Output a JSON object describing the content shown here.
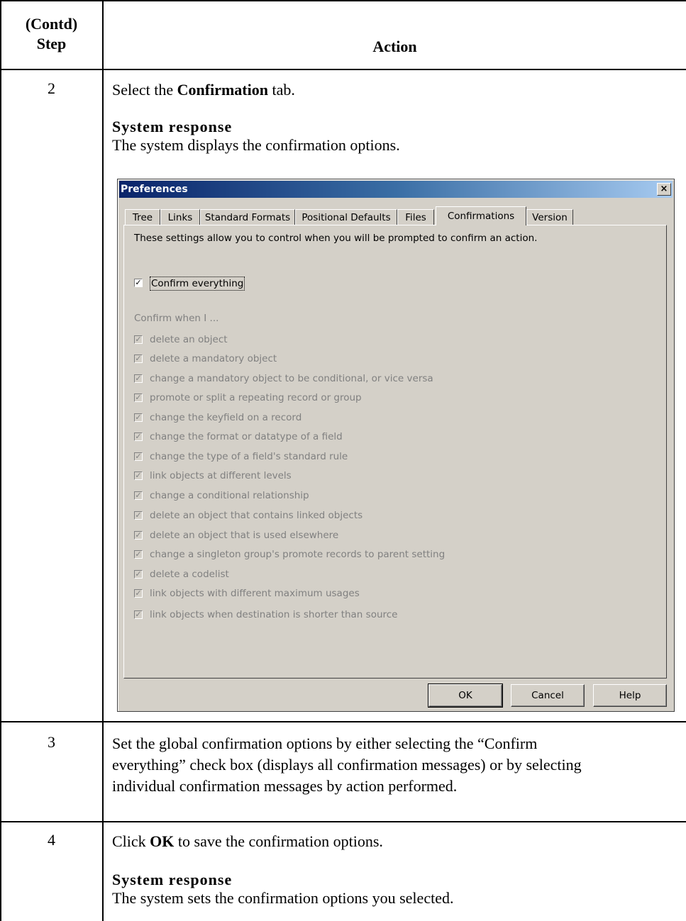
{
  "table": {
    "header_step": "(Contd)\nStep",
    "header_step_line1": "(Contd)",
    "header_step_line2": "Step",
    "header_action": "Action"
  },
  "rows": [
    {
      "step": "2",
      "text_pre": "Select the ",
      "text_bold": "Confirmation",
      "text_post": " tab.",
      "response_label": "System response",
      "response_text": "The system displays the confirmation options."
    },
    {
      "step": "3",
      "text": "Set the global confirmation options by either selecting the “Confirm everything” check box (displays all confirmation messages) or by selecting individual confirmation messages by action performed.",
      "text_line1": "Set the global confirmation options by either selecting the “Confirm",
      "text_line2": "everything” check box (displays all confirmation messages) or by selecting",
      "text_line3": "individual confirmation messages by action performed."
    },
    {
      "step": "4",
      "text_pre": " Click ",
      "text_bold": "OK",
      "text_post": " to save the confirmation options.",
      "response_label": "System response",
      "response_text": "The system sets the confirmation options you selected."
    }
  ],
  "dialog": {
    "title": "Preferences",
    "close_glyph": "×",
    "tabs": [
      "Tree",
      "Links",
      "Standard Formats",
      "Positional Defaults",
      "Files",
      "Confirmations",
      "Version"
    ],
    "active_tab": "Confirmations",
    "intro": "These settings allow you to control when you will be prompted to confirm an action.",
    "confirm_everything_label": "Confirm everything",
    "confirm_everything_checked": true,
    "confirm_when_label": "Confirm when I ...",
    "options": [
      "delete an object",
      "delete a mandatory object",
      "change a mandatory object to be conditional, or vice versa",
      "promote or split a repeating record or group",
      "change the keyfield on a record",
      "change the format or datatype of a field",
      "change the type of a field's standard rule",
      "link objects at different levels",
      "change a conditional relationship",
      "delete an object that contains linked objects",
      "delete an object that is used elsewhere",
      "change a singleton group's promote records to parent setting",
      "delete a codelist",
      "link objects with different maximum usages",
      "link objects when destination is shorter than source"
    ],
    "check_glyph": "✓",
    "buttons": {
      "ok": "OK",
      "cancel": "Cancel",
      "help": "Help"
    }
  }
}
